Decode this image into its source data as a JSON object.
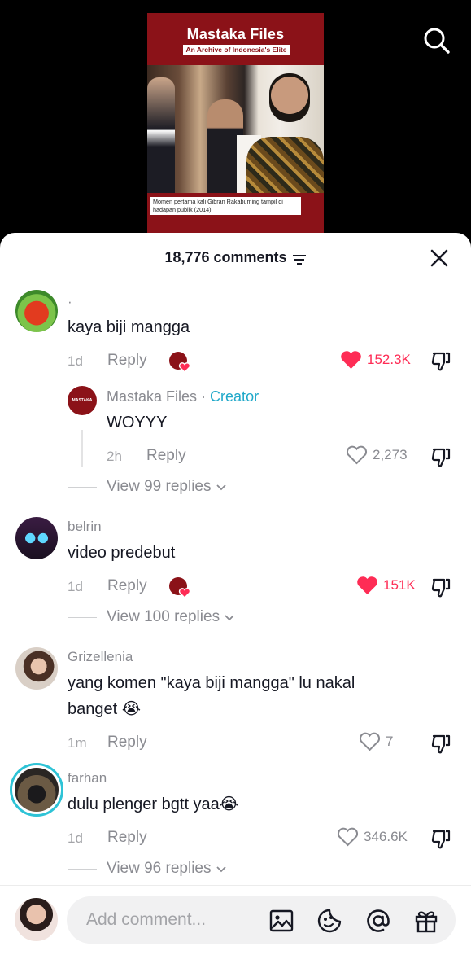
{
  "video": {
    "thumbnail_title": "Mastaka Files",
    "thumbnail_subtitle": "An Archive of Indonesia's Elite",
    "thumbnail_caption": "Momen pertama kali Gibran Rakabuming tampil di hadapan publik (2014)"
  },
  "header": {
    "count_label": "18,776 comments"
  },
  "comments": [
    {
      "username": "·",
      "text": "kaya biji mangga",
      "time": "1d",
      "reply_label": "Reply",
      "likes": "152.3K",
      "liked": true,
      "replies": [
        {
          "username": "Mastaka Files",
          "separator": " · ",
          "badge": "Creator",
          "text": "WOYYY",
          "time": "2h",
          "reply_label": "Reply",
          "likes": "2,273",
          "avatar_text": "MASTAKA"
        }
      ],
      "view_replies": "View 99 replies"
    },
    {
      "username": "belrin",
      "text": "video predebut",
      "time": "1d",
      "reply_label": "Reply",
      "likes": "151K",
      "liked": true,
      "view_replies": "View 100 replies"
    },
    {
      "username": "Grizellenia",
      "text_line1": "yang komen \"kaya biji mangga\" lu nakal",
      "text_line2": "banget 😭",
      "time": "1m",
      "reply_label": "Reply",
      "likes": "7",
      "liked": false
    },
    {
      "username": "farhan",
      "text": "dulu plenger bgtt yaa😭",
      "time": "1d",
      "reply_label": "Reply",
      "likes": "346.6K",
      "liked": false,
      "view_replies": "View 96 replies"
    }
  ],
  "composer": {
    "placeholder": "Add comment..."
  },
  "colors": {
    "accent_red": "#fe2c55",
    "creator_blue": "#1fa8c9",
    "brand_maroon": "#8b1218"
  }
}
